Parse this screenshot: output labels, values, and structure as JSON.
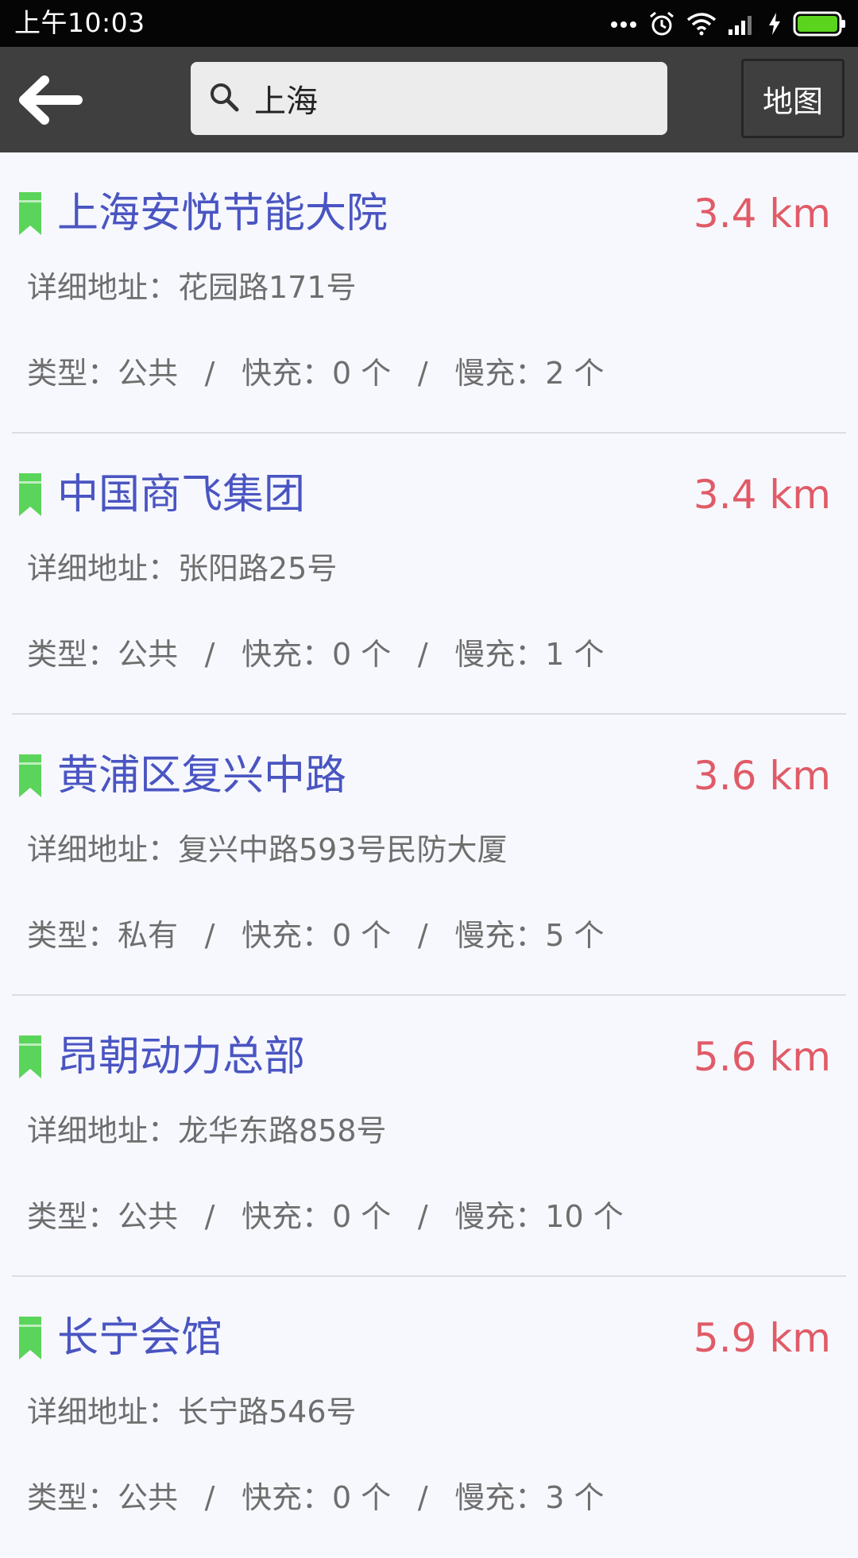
{
  "status_bar": {
    "time": "上午10:03",
    "icons": [
      "more-dots-icon",
      "alarm-icon",
      "wifi-icon",
      "signal-icon",
      "charging-icon",
      "battery-icon"
    ]
  },
  "toolbar": {
    "back_icon": "arrow-left-icon",
    "search_value": "上海",
    "search_icon": "search-icon",
    "map_label": "地图"
  },
  "colors": {
    "toolbar_bg": "#3f3f3f",
    "title": "#4a55c2",
    "distance": "#e05b67",
    "bookmark": "#5bd45b",
    "text_secondary": "#6e6e6e",
    "page_bg": "#f7f8fd"
  },
  "stations": [
    {
      "name": "上海安悦节能大院",
      "distance": "3.4 km",
      "address": "详细地址：花园路171号",
      "type": "类型：公共",
      "fast": "快充：0 个",
      "slow": "慢充：2 个"
    },
    {
      "name": "中国商飞集团",
      "distance": "3.4 km",
      "address": "详细地址：张阳路25号",
      "type": "类型：公共",
      "fast": "快充：0 个",
      "slow": "慢充：1 个"
    },
    {
      "name": "黄浦区复兴中路",
      "distance": "3.6 km",
      "address": "详细地址：复兴中路593号民防大厦",
      "type": "类型：私有",
      "fast": "快充：0 个",
      "slow": "慢充：5 个"
    },
    {
      "name": "昂朝动力总部",
      "distance": "5.6 km",
      "address": "详细地址：龙华东路858号",
      "type": "类型：公共",
      "fast": "快充：0 个",
      "slow": "慢充：10 个"
    },
    {
      "name": "长宁会馆",
      "distance": "5.9 km",
      "address": "详细地址：长宁路546号",
      "type": "类型：公共",
      "fast": "快充：0 个",
      "slow": "慢充：3 个"
    }
  ],
  "meta_separator": "/"
}
